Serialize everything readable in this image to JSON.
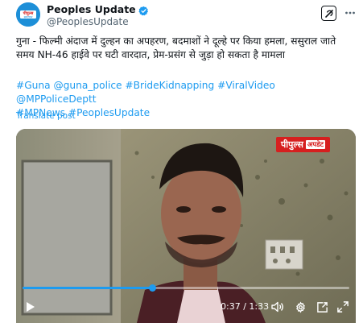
{
  "account": {
    "display_name": "Peoples Update",
    "handle": "@PeoplesUpdate",
    "avatar_text_line1": "पीपुल्स",
    "avatar_text_line2": "समाचार"
  },
  "tweet": {
    "text": "गुना - फिल्मी अंदाज में दुल्हन का अपहरण, बदमाशों ने दूल्हे पर किया हमला, ससुराल जाते समय NH-46 हाईवे पर घटी वारदात, प्रेम-प्रसंग से जुड़ा हो सकता है मामला",
    "tags_line1": "#Guna @guna_police #BrideKidnapping #ViralVideo @MPPoliceDeptt",
    "tags_line2": "#MPNews #PeoplesUpdate",
    "translate_label": "Translate post"
  },
  "video": {
    "brand_main": "पीपुल्स",
    "brand_sub": "अपडेट",
    "time": "0:37 / 1:33",
    "progress": 0.397
  },
  "icons": {
    "verified": "verified-badge-icon",
    "grok": "grok-icon",
    "more": "more-icon",
    "play": "play-icon",
    "volume": "volume-icon",
    "settings": "settings-icon",
    "pip": "picture-in-picture-icon",
    "fullscreen": "fullscreen-icon"
  },
  "colors": {
    "accent": "#1d9bf0",
    "brand_red": "#d61f1f"
  }
}
